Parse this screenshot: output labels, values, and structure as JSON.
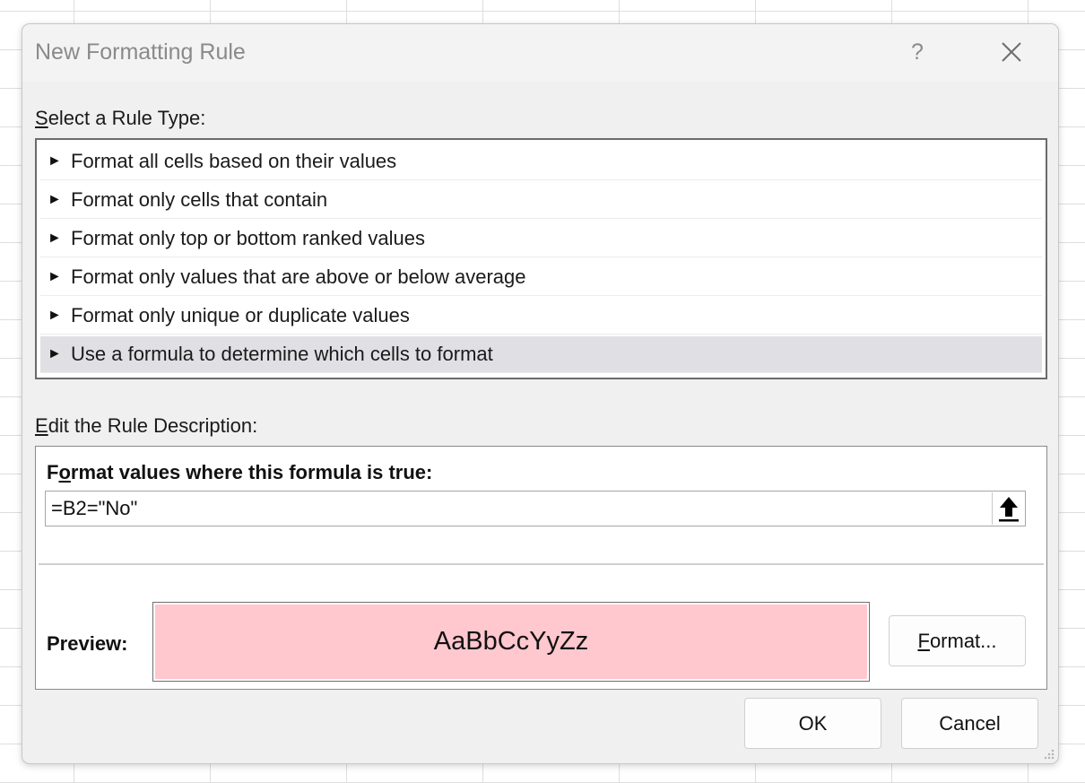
{
  "dialog": {
    "title": "New Formatting Rule",
    "help_label": "?",
    "close_icon": "close-icon"
  },
  "rule_type": {
    "label_prefix": "",
    "label_mnemonic": "S",
    "label_rest": "elect a Rule Type:",
    "arrow_glyph": "►",
    "items": [
      {
        "label": "Format all cells based on their values",
        "selected": false
      },
      {
        "label": "Format only cells that contain",
        "selected": false
      },
      {
        "label": "Format only top or bottom ranked values",
        "selected": false
      },
      {
        "label": "Format only values that are above or below average",
        "selected": false
      },
      {
        "label": "Format only unique or duplicate values",
        "selected": false
      },
      {
        "label": "Use a formula to determine which cells to format",
        "selected": true
      }
    ]
  },
  "description": {
    "label_mnemonic": "E",
    "label_rest": "dit the Rule Description:",
    "heading_prefix": "F",
    "heading_mnemonic": "o",
    "heading_rest": "rmat values where this formula is true:",
    "formula_value": "=B2=\"No\"",
    "collapse_icon": "arrow-up-icon",
    "preview_label": "Preview:",
    "preview_text": "AaBbCcYyZz",
    "preview_fill_color": "#ffc7ce",
    "format_button_mnemonic": "F",
    "format_button_rest": "ormat..."
  },
  "footer": {
    "ok_label": "OK",
    "cancel_label": "Cancel"
  }
}
